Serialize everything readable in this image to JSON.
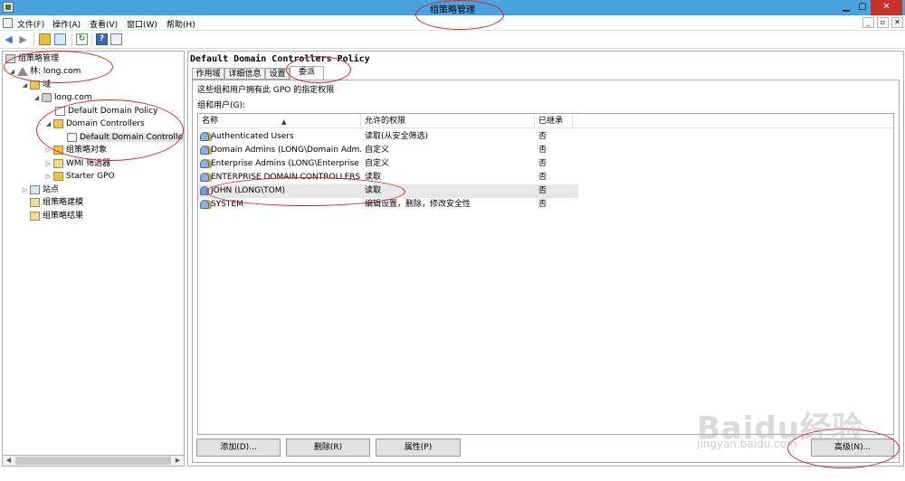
{
  "window": {
    "title": "组策略管理",
    "min_glyph": "▁",
    "max_glyph": "▢",
    "close_glyph": "✕"
  },
  "menubar": {
    "items": [
      "文件(F)",
      "操作(A)",
      "查看(V)",
      "窗口(W)",
      "帮助(H)"
    ],
    "mdi_buttons": [
      "_",
      "▫",
      "✕"
    ]
  },
  "toolbar": {
    "icons": [
      "back-icon",
      "forward-icon",
      "up-folder-icon",
      "show-hide-tree-icon",
      "refresh-icon",
      "help-icon",
      "action-pane-icon"
    ]
  },
  "tree": {
    "root": "组策略管理",
    "forest": "林: long.com",
    "domains": "域",
    "domain": "long.com",
    "default_domain_policy": "Default Domain Policy",
    "domain_controllers": "Domain Controllers",
    "default_dc_policy": "Default Domain Controllers",
    "gpo_objects": "组策略对象",
    "wmi_filters": "WMI 筛选器",
    "starter_gpo": "Starter GPO",
    "sites": "站点",
    "modeling": "组策略建模",
    "results": "组策略结果"
  },
  "panel": {
    "title": "Default Domain Controllers Policy",
    "tabs": [
      "作用域",
      "详细信息",
      "设置",
      "委派"
    ],
    "active_tab": "委派",
    "description": "这些组和用户拥有此 GPO 的指定权限",
    "groups_label": "组和用户(G):"
  },
  "table": {
    "columns": [
      "名称",
      "允许的权限",
      "已继承"
    ],
    "rows": [
      {
        "name": "Authenticated Users",
        "permission": "读取(从安全筛选)",
        "inherited": "否"
      },
      {
        "name": "Domain Admins (LONG\\Domain Adm...",
        "permission": "自定义",
        "inherited": "否"
      },
      {
        "name": "Enterprise Admins (LONG\\Enterprise ...",
        "permission": "自定义",
        "inherited": "否"
      },
      {
        "name": "ENTERPRISE DOMAIN CONTROLLERS",
        "permission": "读取",
        "inherited": "否"
      },
      {
        "name": "JOHN (LONG\\TOM)",
        "permission": "读取",
        "inherited": "否"
      },
      {
        "name": "SYSTEM",
        "permission": "编辑设置，删除，修改安全性",
        "inherited": "否"
      }
    ],
    "selected_row": "JOHN (LONG\\TOM)"
  },
  "buttons": {
    "add": "添加(D)...",
    "remove": "删除(R)",
    "properties": "属性(P)",
    "advanced": "高级(N)..."
  },
  "watermark": {
    "brand": "Baidu经验",
    "url": "jingyan.baidu.com"
  },
  "annotation_color": "#d4242c"
}
